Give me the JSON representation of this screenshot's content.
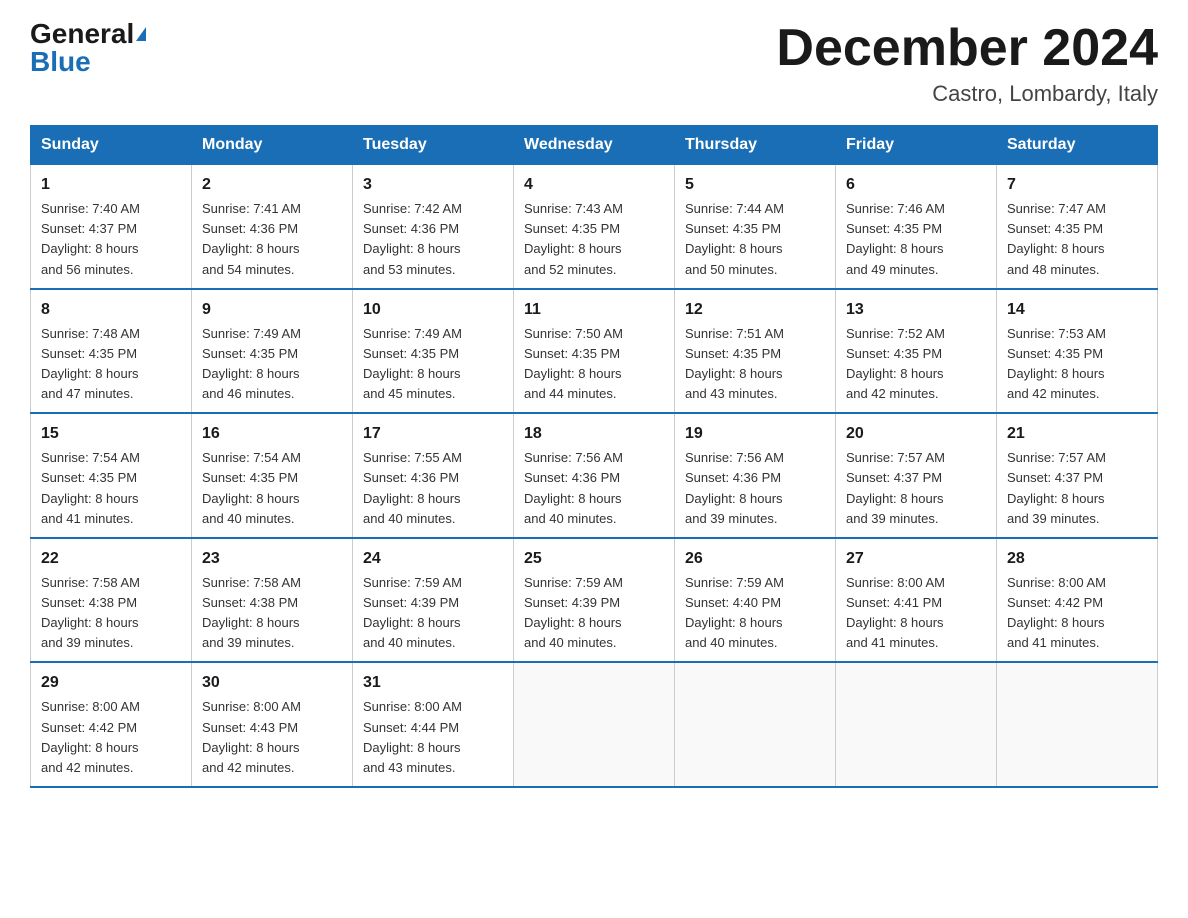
{
  "header": {
    "logo_general": "General",
    "logo_blue": "Blue",
    "month_title": "December 2024",
    "location": "Castro, Lombardy, Italy"
  },
  "days_of_week": [
    "Sunday",
    "Monday",
    "Tuesday",
    "Wednesday",
    "Thursday",
    "Friday",
    "Saturday"
  ],
  "weeks": [
    [
      {
        "day": "1",
        "sunrise": "7:40 AM",
        "sunset": "4:37 PM",
        "daylight": "8 hours and 56 minutes."
      },
      {
        "day": "2",
        "sunrise": "7:41 AM",
        "sunset": "4:36 PM",
        "daylight": "8 hours and 54 minutes."
      },
      {
        "day": "3",
        "sunrise": "7:42 AM",
        "sunset": "4:36 PM",
        "daylight": "8 hours and 53 minutes."
      },
      {
        "day": "4",
        "sunrise": "7:43 AM",
        "sunset": "4:35 PM",
        "daylight": "8 hours and 52 minutes."
      },
      {
        "day": "5",
        "sunrise": "7:44 AM",
        "sunset": "4:35 PM",
        "daylight": "8 hours and 50 minutes."
      },
      {
        "day": "6",
        "sunrise": "7:46 AM",
        "sunset": "4:35 PM",
        "daylight": "8 hours and 49 minutes."
      },
      {
        "day": "7",
        "sunrise": "7:47 AM",
        "sunset": "4:35 PM",
        "daylight": "8 hours and 48 minutes."
      }
    ],
    [
      {
        "day": "8",
        "sunrise": "7:48 AM",
        "sunset": "4:35 PM",
        "daylight": "8 hours and 47 minutes."
      },
      {
        "day": "9",
        "sunrise": "7:49 AM",
        "sunset": "4:35 PM",
        "daylight": "8 hours and 46 minutes."
      },
      {
        "day": "10",
        "sunrise": "7:49 AM",
        "sunset": "4:35 PM",
        "daylight": "8 hours and 45 minutes."
      },
      {
        "day": "11",
        "sunrise": "7:50 AM",
        "sunset": "4:35 PM",
        "daylight": "8 hours and 44 minutes."
      },
      {
        "day": "12",
        "sunrise": "7:51 AM",
        "sunset": "4:35 PM",
        "daylight": "8 hours and 43 minutes."
      },
      {
        "day": "13",
        "sunrise": "7:52 AM",
        "sunset": "4:35 PM",
        "daylight": "8 hours and 42 minutes."
      },
      {
        "day": "14",
        "sunrise": "7:53 AM",
        "sunset": "4:35 PM",
        "daylight": "8 hours and 42 minutes."
      }
    ],
    [
      {
        "day": "15",
        "sunrise": "7:54 AM",
        "sunset": "4:35 PM",
        "daylight": "8 hours and 41 minutes."
      },
      {
        "day": "16",
        "sunrise": "7:54 AM",
        "sunset": "4:35 PM",
        "daylight": "8 hours and 40 minutes."
      },
      {
        "day": "17",
        "sunrise": "7:55 AM",
        "sunset": "4:36 PM",
        "daylight": "8 hours and 40 minutes."
      },
      {
        "day": "18",
        "sunrise": "7:56 AM",
        "sunset": "4:36 PM",
        "daylight": "8 hours and 40 minutes."
      },
      {
        "day": "19",
        "sunrise": "7:56 AM",
        "sunset": "4:36 PM",
        "daylight": "8 hours and 39 minutes."
      },
      {
        "day": "20",
        "sunrise": "7:57 AM",
        "sunset": "4:37 PM",
        "daylight": "8 hours and 39 minutes."
      },
      {
        "day": "21",
        "sunrise": "7:57 AM",
        "sunset": "4:37 PM",
        "daylight": "8 hours and 39 minutes."
      }
    ],
    [
      {
        "day": "22",
        "sunrise": "7:58 AM",
        "sunset": "4:38 PM",
        "daylight": "8 hours and 39 minutes."
      },
      {
        "day": "23",
        "sunrise": "7:58 AM",
        "sunset": "4:38 PM",
        "daylight": "8 hours and 39 minutes."
      },
      {
        "day": "24",
        "sunrise": "7:59 AM",
        "sunset": "4:39 PM",
        "daylight": "8 hours and 40 minutes."
      },
      {
        "day": "25",
        "sunrise": "7:59 AM",
        "sunset": "4:39 PM",
        "daylight": "8 hours and 40 minutes."
      },
      {
        "day": "26",
        "sunrise": "7:59 AM",
        "sunset": "4:40 PM",
        "daylight": "8 hours and 40 minutes."
      },
      {
        "day": "27",
        "sunrise": "8:00 AM",
        "sunset": "4:41 PM",
        "daylight": "8 hours and 41 minutes."
      },
      {
        "day": "28",
        "sunrise": "8:00 AM",
        "sunset": "4:42 PM",
        "daylight": "8 hours and 41 minutes."
      }
    ],
    [
      {
        "day": "29",
        "sunrise": "8:00 AM",
        "sunset": "4:42 PM",
        "daylight": "8 hours and 42 minutes."
      },
      {
        "day": "30",
        "sunrise": "8:00 AM",
        "sunset": "4:43 PM",
        "daylight": "8 hours and 42 minutes."
      },
      {
        "day": "31",
        "sunrise": "8:00 AM",
        "sunset": "4:44 PM",
        "daylight": "8 hours and 43 minutes."
      },
      null,
      null,
      null,
      null
    ]
  ],
  "labels": {
    "sunrise": "Sunrise:",
    "sunset": "Sunset:",
    "daylight": "Daylight:"
  }
}
